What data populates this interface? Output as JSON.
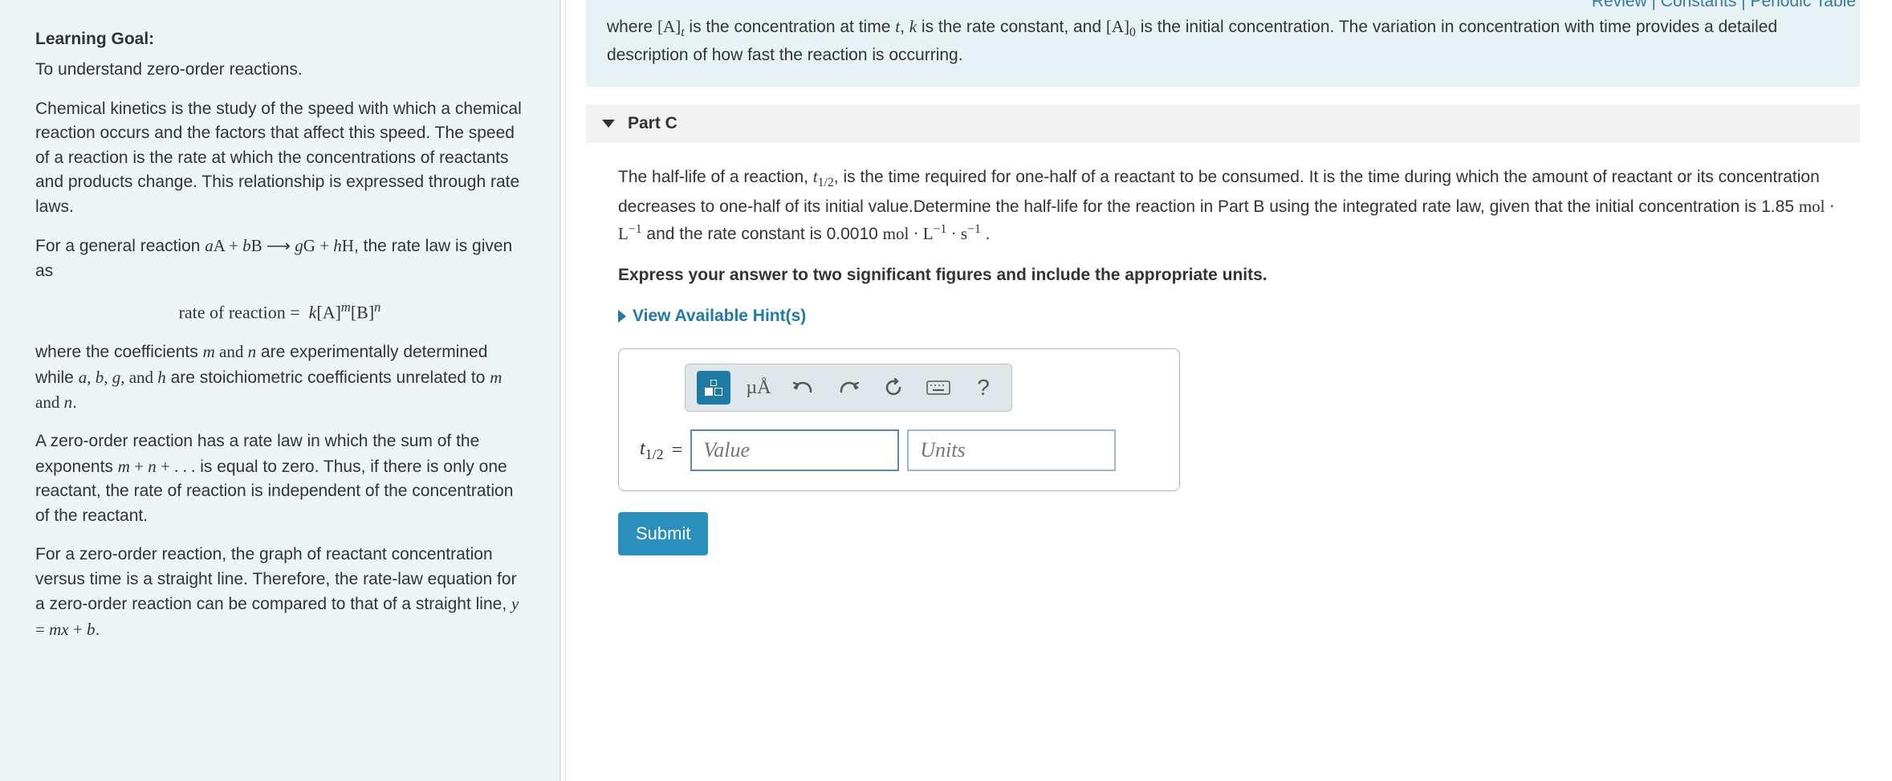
{
  "top_links": "Review | Constants | Periodic Table",
  "left": {
    "heading": "Learning Goal:",
    "p1": "To understand zero-order reactions.",
    "p2": "Chemical kinetics is the study of the speed with which a chemical reaction occurs and the factors that affect this speed. The speed of a reaction is the rate at which the concentrations of reactants and products change. This relationship is expressed through rate laws.",
    "p3a": "For a general reaction ",
    "p3b": ", the rate law is given as",
    "p4a": "where the coefficients ",
    "p4b": " are experimentally determined while ",
    "p4c": " are stoichiometric coefficients unrelated to ",
    "p4d": ".",
    "p5a": "A zero-order reaction has a rate law in which the sum of the exponents ",
    "p5b": " is equal to zero. Thus, if there is only one reactant, the rate of reaction is independent of the concentration of the reactant.",
    "p6a": "For a zero-order reaction, the graph of reactant concentration versus time is a straight line. Therefore, the rate-law equation for a zero-order reaction can be compared to that of a straight line, ",
    "p6b": "."
  },
  "intro": "where [A]ₜ is the concentration at time t, k is the rate constant, and [A]₀ is the initial concentration. The variation in concentration with time provides a detailed description of how fast the reaction is occurring.",
  "part": {
    "label": "Part C",
    "q1a": "The half-life of a reaction, ",
    "q1b": ", is the time required for one-half of a reactant to be consumed. It is the time during which the amount of reactant or its concentration decreases to one-half of its initial value.Determine the half-life for the reaction in Part B using the integrated rate law, given that the initial concentration is 1.85 ",
    "q1c": " and the rate constant is 0.0010 ",
    "q1d": " .",
    "instruct": "Express your answer to two significant figures and include the appropriate units.",
    "hints": "View Available Hint(s)",
    "units_btn": "µÅ",
    "help_btn": "?",
    "lhs": "t",
    "eq": " = ",
    "value_ph": "Value",
    "units_ph": "Units",
    "submit": "Submit"
  }
}
